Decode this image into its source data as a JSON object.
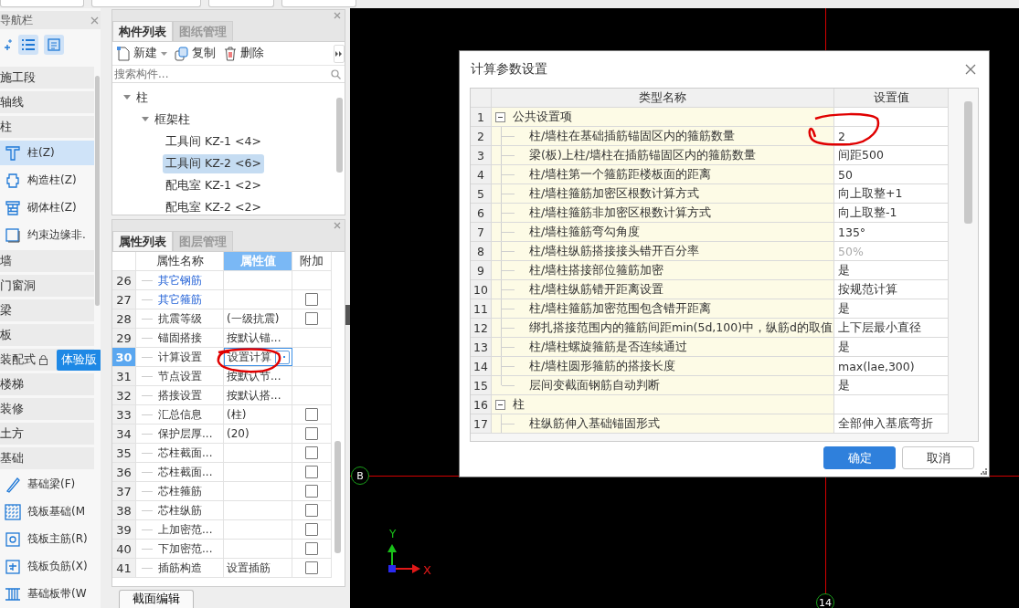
{
  "nav": {
    "title": "导航栏",
    "groups": [
      {
        "label": "施工段"
      },
      {
        "label": "轴线"
      },
      {
        "label": "柱",
        "children": [
          {
            "label": "柱(Z)",
            "selected": true
          },
          {
            "label": "构造柱(Z)",
            "selected": false
          },
          {
            "label": "砌体柱(Z)",
            "selected": false
          },
          {
            "label": "约束边缘非.",
            "selected": false
          }
        ]
      },
      {
        "label": "墙"
      },
      {
        "label": "门窗洞"
      },
      {
        "label": "梁"
      },
      {
        "label": "板"
      },
      {
        "label": "装配式",
        "locked": true,
        "badge": "体验版"
      },
      {
        "label": "楼梯"
      },
      {
        "label": "装修"
      },
      {
        "label": "土方"
      },
      {
        "label": "基础",
        "children": [
          {
            "label": "基础梁(F)",
            "selected": false
          },
          {
            "label": "筏板基础(M",
            "selected": false
          },
          {
            "label": "筏板主筋(R)",
            "selected": false
          },
          {
            "label": "筏板负筋(X)",
            "selected": false
          },
          {
            "label": "基础板带(W",
            "selected": false
          }
        ]
      }
    ]
  },
  "component_panel": {
    "tabs": [
      {
        "label": "构件列表",
        "selected": true
      },
      {
        "label": "图纸管理",
        "selected": false
      }
    ],
    "actions": [
      {
        "label": "新建",
        "kind": "new"
      },
      {
        "label": "复制",
        "kind": "copy"
      },
      {
        "label": "删除",
        "kind": "delete"
      }
    ],
    "search": {
      "placeholder": "搜索构件..."
    },
    "tree": [
      {
        "label": "柱",
        "expanded": true,
        "children": [
          {
            "label": "框架柱",
            "expanded": true,
            "children": [
              {
                "label": "工具间 KZ-1 <4>",
                "selected": false
              },
              {
                "label": "工具间 KZ-2 <6>",
                "selected": true
              },
              {
                "label": "配电室 KZ-1 <2>",
                "selected": false
              },
              {
                "label": "配电室 KZ-2 <2>",
                "selected": false
              }
            ]
          }
        ]
      }
    ]
  },
  "property_panel": {
    "tabs": [
      {
        "label": "属性列表",
        "selected": true
      },
      {
        "label": "图层管理",
        "selected": false
      }
    ],
    "columns": [
      "属性名称",
      "属性值",
      "附加"
    ],
    "rows": [
      {
        "num": "26",
        "name": "其它钢筋",
        "kind": "link",
        "selected": false
      },
      {
        "num": "27",
        "name": "其它箍筋",
        "kind": "link",
        "selected": false,
        "checked": false
      },
      {
        "num": "28",
        "name": "抗震等级",
        "kind": "text",
        "value": "(一级抗震)",
        "selected": false,
        "checked": false
      },
      {
        "num": "29",
        "name": "锚固搭接",
        "kind": "text",
        "value": "按默认锚...",
        "selected": false
      },
      {
        "num": "30",
        "name": "计算设置",
        "kind": "text",
        "value": "设置计算",
        "selected": true
      },
      {
        "num": "31",
        "name": "节点设置",
        "kind": "text",
        "value": "按默认节...",
        "selected": false
      },
      {
        "num": "32",
        "name": "搭接设置",
        "kind": "text",
        "value": "按默认搭...",
        "selected": false
      },
      {
        "num": "33",
        "name": "汇总信息",
        "kind": "text",
        "value": "(柱)",
        "selected": false,
        "checked": false
      },
      {
        "num": "34",
        "name": "保护层厚...",
        "kind": "text",
        "value": "(20)",
        "selected": false,
        "checked": false
      },
      {
        "num": "35",
        "name": "芯柱截面...",
        "kind": "text",
        "selected": false,
        "checked": false
      },
      {
        "num": "36",
        "name": "芯柱截面...",
        "kind": "text",
        "selected": false,
        "checked": false
      },
      {
        "num": "37",
        "name": "芯柱箍筋",
        "kind": "text",
        "selected": false,
        "checked": false
      },
      {
        "num": "38",
        "name": "芯柱纵筋",
        "kind": "text",
        "selected": false,
        "checked": false
      },
      {
        "num": "39",
        "name": "上加密范...",
        "kind": "text",
        "selected": false,
        "checked": false
      },
      {
        "num": "40",
        "name": "下加密范...",
        "kind": "text",
        "selected": false,
        "checked": false
      },
      {
        "num": "41",
        "name": "插筋构造",
        "kind": "text",
        "value": "设置插筋",
        "selected": false,
        "checked": false
      }
    ],
    "button": "截面编辑"
  },
  "canvas": {
    "markers": [
      {
        "label": "B",
        "kind": "row"
      },
      {
        "label": "14",
        "kind": "column"
      }
    ],
    "axes": {
      "x": "X",
      "y": "Y"
    }
  },
  "dialog": {
    "title": "计算参数设置",
    "columns": [
      "类型名称",
      "设置值"
    ],
    "rows": [
      {
        "num": "1",
        "name": "公共设置项",
        "expanded": true,
        "children": [
          {
            "num": "2",
            "name": "柱/墙柱在基础插筋锚固区内的箍筋数量",
            "value": "2",
            "disabled": false
          },
          {
            "num": "3",
            "name": "梁(板)上柱/墙柱在插筋锚固区内的箍筋数量",
            "value": "间距500",
            "disabled": false
          },
          {
            "num": "4",
            "name": "柱/墙柱第一个箍筋距楼板面的距离",
            "value": "50",
            "disabled": false
          },
          {
            "num": "5",
            "name": "柱/墙柱箍筋加密区根数计算方式",
            "value": "向上取整+1",
            "disabled": false
          },
          {
            "num": "6",
            "name": "柱/墙柱箍筋非加密区根数计算方式",
            "value": "向上取整-1",
            "disabled": false
          },
          {
            "num": "7",
            "name": "柱/墙柱箍筋弯勾角度",
            "value": "135°",
            "disabled": false
          },
          {
            "num": "8",
            "name": "柱/墙柱纵筋搭接接头错开百分率",
            "value": "50%",
            "disabled": true
          },
          {
            "num": "9",
            "name": "柱/墙柱搭接部位箍筋加密",
            "value": "是",
            "disabled": false
          },
          {
            "num": "10",
            "name": "柱/墙柱纵筋错开距离设置",
            "value": "按规范计算",
            "disabled": false
          },
          {
            "num": "11",
            "name": "柱/墙柱箍筋加密范围包含错开距离",
            "value": "是",
            "disabled": false
          },
          {
            "num": "12",
            "name": "绑扎搭接范围内的箍筋间距min(5d,100)中，纵筋d的取值",
            "value": "上下层最小直径",
            "disabled": false
          },
          {
            "num": "13",
            "name": "柱/墙柱螺旋箍筋是否连续通过",
            "value": "是",
            "disabled": false
          },
          {
            "num": "14",
            "name": "柱/墙柱圆形箍筋的搭接长度",
            "value": "max(lae,300)",
            "disabled": false
          },
          {
            "num": "15",
            "name": "层间变截面钢筋自动判断",
            "value": "是",
            "disabled": false
          }
        ]
      },
      {
        "num": "16",
        "name": "柱",
        "expanded": true,
        "children": [
          {
            "num": "17",
            "name": "柱纵筋伸入基础锚固形式",
            "value": "全部伸入基底弯折",
            "disabled": false
          }
        ]
      }
    ],
    "buttons": [
      {
        "label": "确定",
        "kind": "primary"
      },
      {
        "label": "取消",
        "kind": "secondary"
      }
    ]
  }
}
